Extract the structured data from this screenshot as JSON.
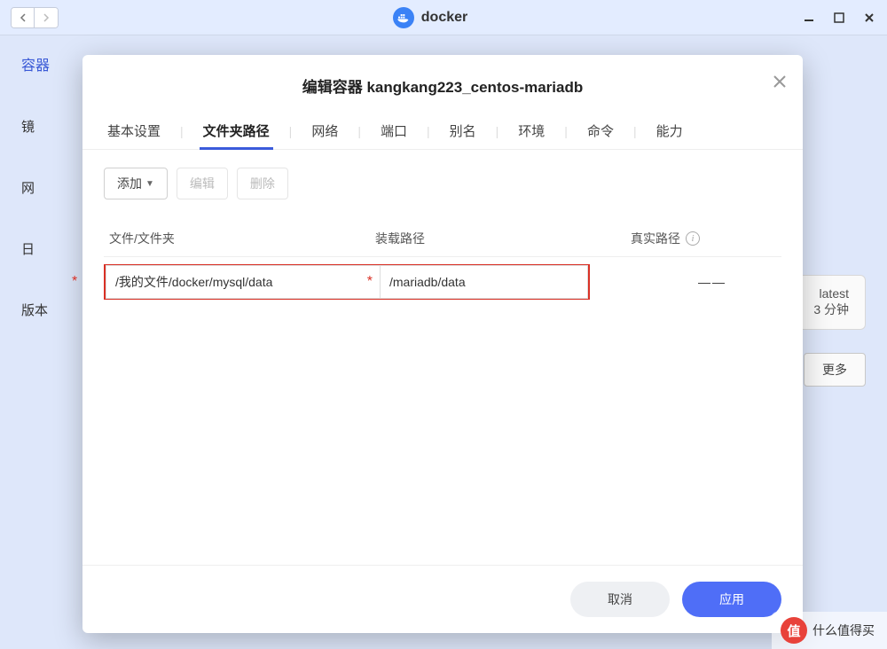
{
  "app": {
    "title": "docker"
  },
  "sidebar": {
    "label0": "容器",
    "label1": "镜",
    "label2": "网",
    "label3": "日",
    "label4": "版本"
  },
  "peek": {
    "line1": "latest",
    "line2": "3 分钟",
    "more": "更多"
  },
  "modal": {
    "title": "编辑容器 kangkang223_centos-mariadb",
    "tabs": [
      "基本设置",
      "文件夹路径",
      "网络",
      "端口",
      "别名",
      "环境",
      "命令",
      "能力"
    ],
    "toolbar": {
      "add": "添加",
      "edit": "编辑",
      "delete": "删除"
    },
    "columns": {
      "c1": "文件/文件夹",
      "c2": "装载路径",
      "c3": "真实路径"
    },
    "row": {
      "file": "/我的文件/docker/mysql/data",
      "mount": "/mariadb/data",
      "real": "——"
    },
    "footer": {
      "cancel": "取消",
      "apply": "应用"
    }
  },
  "watermark": {
    "icon": "值",
    "text": "什么值得买"
  }
}
